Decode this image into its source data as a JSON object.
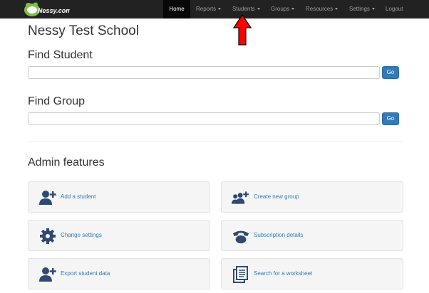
{
  "navbar": {
    "brand": "Nessy.com",
    "items": [
      {
        "label": "Home",
        "active": true,
        "dropdown": false
      },
      {
        "label": "Reports",
        "active": false,
        "dropdown": true
      },
      {
        "label": "Students",
        "active": false,
        "dropdown": true
      },
      {
        "label": "Groups",
        "active": false,
        "dropdown": true
      },
      {
        "label": "Resources",
        "active": false,
        "dropdown": true
      },
      {
        "label": "Settings",
        "active": false,
        "dropdown": true
      },
      {
        "label": "Logout",
        "active": false,
        "dropdown": false
      }
    ]
  },
  "page": {
    "school_name": "Nessy Test School"
  },
  "find_student": {
    "title": "Find Student",
    "value": "",
    "button_label": "Go"
  },
  "find_group": {
    "title": "Find Group",
    "value": "",
    "button_label": "Go"
  },
  "admin": {
    "title": "Admin features",
    "features": [
      {
        "label": "Add a student",
        "icon": "add-user-icon"
      },
      {
        "label": "Create new group",
        "icon": "add-group-icon"
      },
      {
        "label": "Change settings",
        "icon": "gear-icon"
      },
      {
        "label": "Subscription details",
        "icon": "phone-icon"
      },
      {
        "label": "Export student data",
        "icon": "add-user-icon"
      },
      {
        "label": "Search for a worksheet",
        "icon": "document-icon"
      }
    ]
  },
  "colors": {
    "navbar_bg": "#222222",
    "nav_active_bg": "#080808",
    "primary": "#337ab7",
    "icon_color": "#2e4a73",
    "brand_green": "#6ab04c",
    "annotation_red": "#ff0000"
  }
}
